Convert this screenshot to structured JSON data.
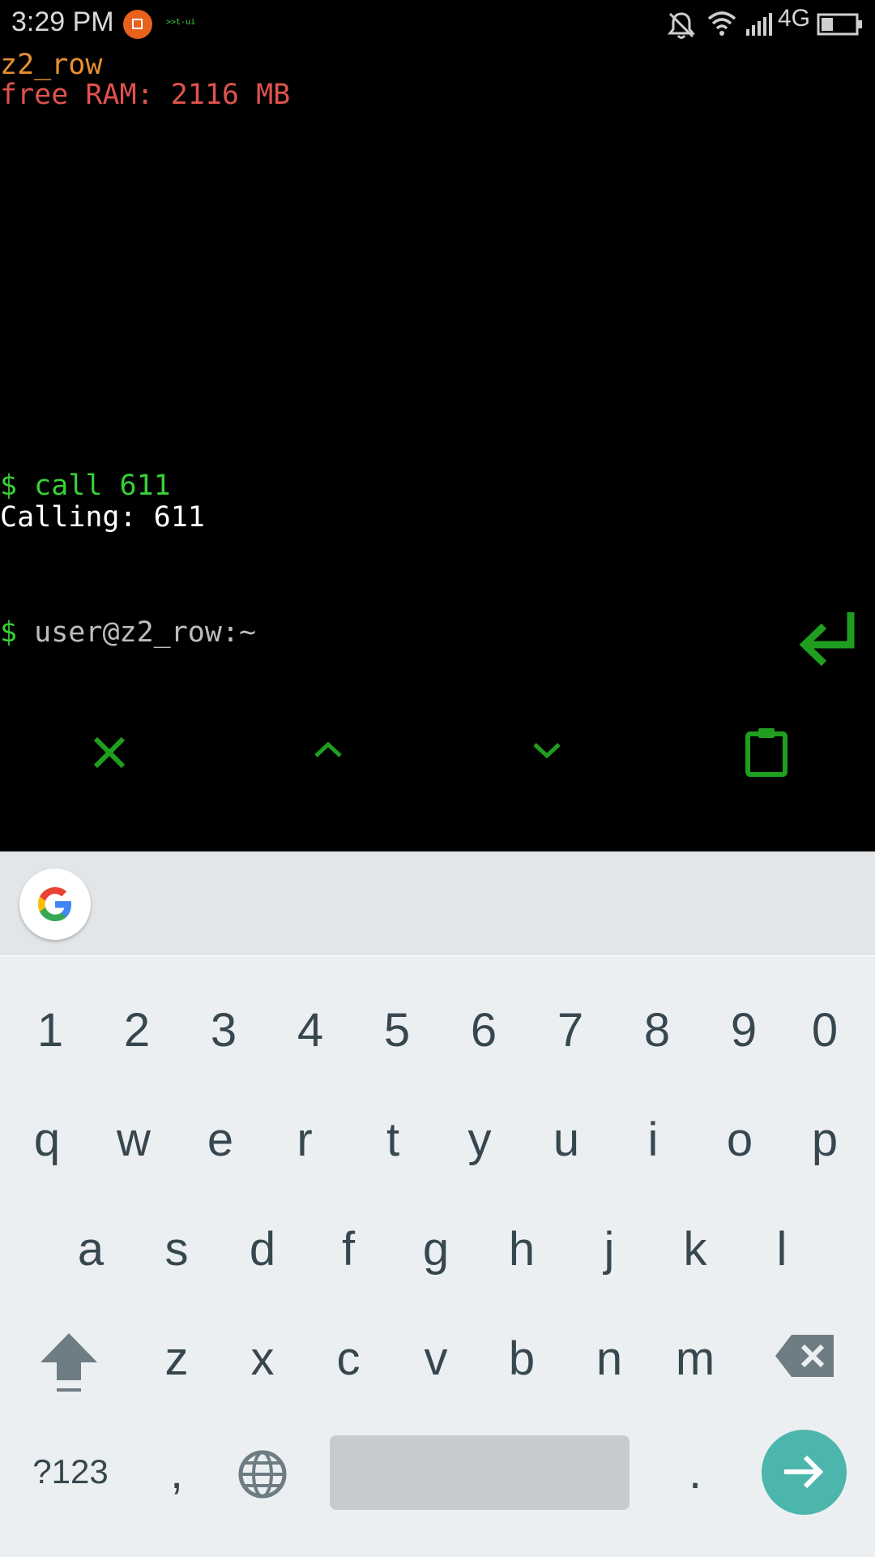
{
  "status_bar": {
    "time": "3:29 PM",
    "app_mini_label": ">>t-ui",
    "network_type": "4G",
    "icons": [
      "notification-app-icon",
      "mute-icon",
      "wifi-icon",
      "signal-icon",
      "battery-icon"
    ]
  },
  "terminal": {
    "hostname": "z2_row",
    "ram_info": "free RAM: 2116 MB",
    "command": "$ call 611",
    "output": "Calling: 611",
    "prompt_symbol": "$ ",
    "prompt_text": "user@z2_row:~",
    "colors": {
      "host": "#e8902e",
      "ram": "#e0524d",
      "command": "#36d136",
      "output": "#ffffff",
      "tools": "#1f9e1f"
    },
    "tools": [
      "close-icon",
      "chevron-up-icon",
      "chevron-down-icon",
      "clipboard-icon",
      "enter-arrow-icon"
    ]
  },
  "keyboard": {
    "number_row": [
      "1",
      "2",
      "3",
      "4",
      "5",
      "6",
      "7",
      "8",
      "9",
      "0"
    ],
    "row1": [
      "q",
      "w",
      "e",
      "r",
      "t",
      "y",
      "u",
      "i",
      "o",
      "p"
    ],
    "row2": [
      "a",
      "s",
      "d",
      "f",
      "g",
      "h",
      "j",
      "k",
      "l"
    ],
    "row3": [
      "z",
      "x",
      "c",
      "v",
      "b",
      "n",
      "m"
    ],
    "symbols_key": "?123",
    "comma_key": ",",
    "period_key": ".",
    "enter_color": "#4db6ac",
    "space_color": "#c7cbcf"
  }
}
